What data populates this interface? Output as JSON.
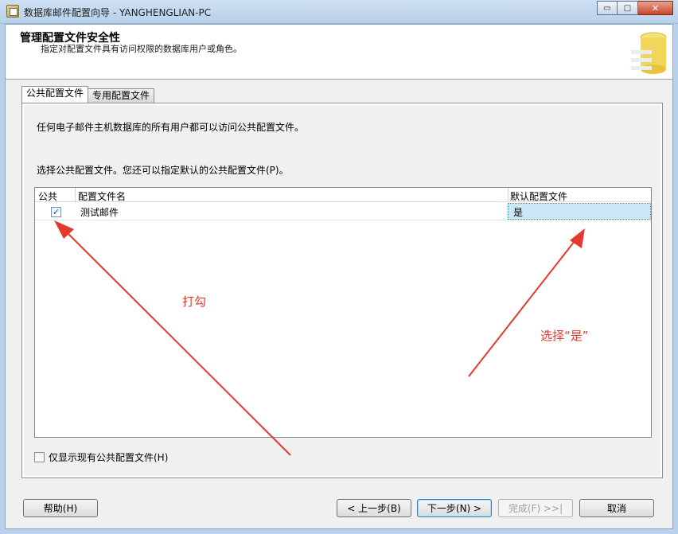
{
  "window": {
    "title": "数据库邮件配置向导 - YANGHENGLIAN-PC",
    "minimize_glyph": "▭",
    "maximize_glyph": "□",
    "close_glyph": "✕"
  },
  "header": {
    "title": "管理配置文件安全性",
    "subtitle": "指定对配置文件具有访问权限的数据库用户或角色。"
  },
  "tabs": [
    {
      "label": "公共配置文件",
      "active": true
    },
    {
      "label": "专用配置文件",
      "active": false
    }
  ],
  "panel": {
    "description1": "任何电子邮件主机数据库的所有用户都可以访问公共配置文件。",
    "description2": "选择公共配置文件。您还可以指定默认的公共配置文件(P)。"
  },
  "grid": {
    "columns": [
      "公共",
      "配置文件名",
      "默认配置文件"
    ],
    "rows": [
      {
        "public": true,
        "check_glyph": "✓",
        "name": "测试邮件",
        "default": "是"
      }
    ]
  },
  "options": {
    "show_existing_label": "仅显示现有公共配置文件(H)",
    "show_existing_checked": false
  },
  "buttons": {
    "help": "帮助(H)",
    "back": "< 上一步(B)",
    "next": "下一步(N) >",
    "finish": "完成(F) >>|",
    "cancel": "取消"
  },
  "annotations": {
    "check_note": "打勾",
    "select_note": "选择“是”",
    "color": "#e23a2e"
  }
}
